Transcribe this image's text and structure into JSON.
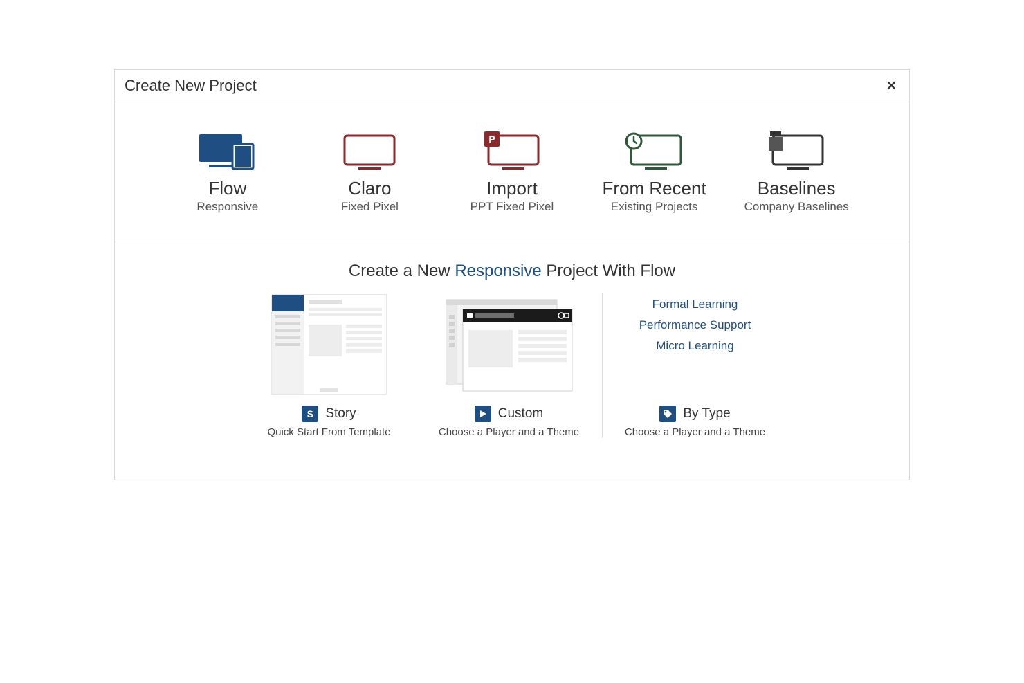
{
  "dialog": {
    "title": "Create New Project"
  },
  "tabs": {
    "flow": {
      "title": "Flow",
      "sub": "Responsive"
    },
    "claro": {
      "title": "Claro",
      "sub": "Fixed Pixel"
    },
    "import": {
      "title": "Import",
      "sub": "PPT Fixed Pixel"
    },
    "recent": {
      "title": "From Recent",
      "sub": "Existing Projects"
    },
    "base": {
      "title": "Baselines",
      "sub": "Company Baselines"
    }
  },
  "section": {
    "prefix": "Create a New ",
    "highlight": "Responsive",
    "suffix": " Project With Flow"
  },
  "options": {
    "story": {
      "badge": "S",
      "label": "Story",
      "sub": "Quick Start From Template"
    },
    "custom": {
      "label": "Custom",
      "sub": "Choose a Player and a Theme"
    },
    "bytype": {
      "label": "By Type",
      "sub": "Choose a Player and a Theme",
      "types": [
        "Formal Learning",
        "Performance Support",
        "Micro Learning"
      ]
    }
  }
}
